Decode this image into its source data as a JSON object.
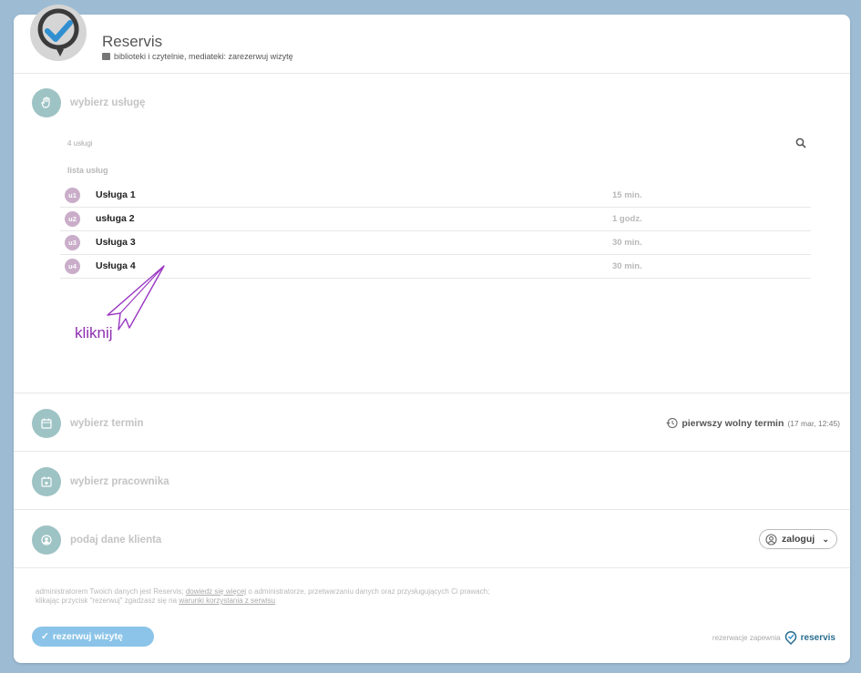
{
  "header": {
    "brand": "Reservis",
    "subtitle": "biblioteki i czytelnie, mediateki: zarezerwuj wizytę"
  },
  "section_service": {
    "title": "wybierz usługę",
    "count": "4 usługi",
    "list_label": "lista usług",
    "items": [
      {
        "badge": "u1",
        "name": "Usługa 1",
        "duration": "15 min."
      },
      {
        "badge": "u2",
        "name": "usługa 2",
        "duration": "1 godz."
      },
      {
        "badge": "u3",
        "name": "Usługa 3",
        "duration": "30 min."
      },
      {
        "badge": "u4",
        "name": "Usługa 4",
        "duration": "30 min."
      }
    ]
  },
  "annotation": "kliknij",
  "section_term": {
    "title": "wybierz termin",
    "first_free_label": "pierwszy wolny termin",
    "first_free_value": "(17 mar, 12:45)"
  },
  "section_worker": {
    "title": "wybierz pracownika"
  },
  "section_client": {
    "title": "podaj dane klienta",
    "login_label": "zaloguj"
  },
  "legal": {
    "line1_a": "administratorem Twoich danych jest Reservis;",
    "line1_link": "dowiedz się więcej",
    "line1_b": "o administratorze, przetwarzaniu danych oraz przysługujących Ci prawach;",
    "line2_a": "klikając przycisk \"rezerwuj\" zgadzasz się na",
    "line2_link": "warunki korzystania z serwisu"
  },
  "reserve_button": "rezerwuj wizytę",
  "footer": {
    "powered": "rezerwacje zapewnia",
    "logo_text": "reservis"
  },
  "colors": {
    "background": "#9dbcd4",
    "section_icon": "#9ec3c4",
    "badge": "#c9adc9",
    "button": "#8bc4e8",
    "annotation": "#8e2fb0"
  }
}
